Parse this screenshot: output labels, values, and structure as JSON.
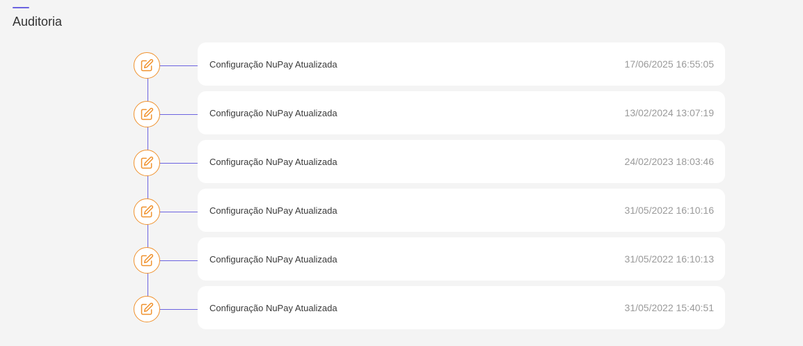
{
  "page": {
    "title": "Auditoria"
  },
  "colors": {
    "accent": "#6c63e0",
    "icon": "#f0922e",
    "background": "#f4f4f4",
    "card": "#ffffff"
  },
  "entries": [
    {
      "label": "Configuração NuPay Atualizada",
      "timestamp": "17/06/2025 16:55:05",
      "icon": "edit-icon"
    },
    {
      "label": "Configuração NuPay Atualizada",
      "timestamp": "13/02/2024 13:07:19",
      "icon": "edit-icon"
    },
    {
      "label": "Configuração NuPay Atualizada",
      "timestamp": "24/02/2023 18:03:46",
      "icon": "edit-icon"
    },
    {
      "label": "Configuração NuPay Atualizada",
      "timestamp": "31/05/2022 16:10:16",
      "icon": "edit-icon"
    },
    {
      "label": "Configuração NuPay Atualizada",
      "timestamp": "31/05/2022 16:10:13",
      "icon": "edit-icon"
    },
    {
      "label": "Configuração NuPay Atualizada",
      "timestamp": "31/05/2022 15:40:51",
      "icon": "edit-icon"
    }
  ]
}
